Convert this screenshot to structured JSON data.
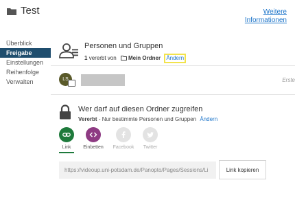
{
  "header": {
    "title": "Test",
    "more_info": "Weitere Informationen"
  },
  "sidebar": {
    "items": [
      {
        "label": "Überblick",
        "active": false
      },
      {
        "label": "Freigabe",
        "active": true
      },
      {
        "label": "Einstellungen",
        "active": false
      },
      {
        "label": "Reihenfolge",
        "active": false
      },
      {
        "label": "Verwalten",
        "active": false
      }
    ]
  },
  "people": {
    "title": "Personen und Gruppen",
    "inherited_count": "1",
    "inherited_text": "vererbt von",
    "folder_name": "Mein Ordner",
    "change_link": "Ändern"
  },
  "user_row": {
    "initials": "LS",
    "role": "Erste"
  },
  "access": {
    "title": "Wer darf auf diesen Ordner zugreifen",
    "status": "Vererbt",
    "status_detail": "- Nur bestimmte Personen und Gruppen",
    "change_link": "Ändern"
  },
  "share_options": [
    {
      "label": "Link",
      "icon": "link-icon",
      "color": "#1e7a3c",
      "selected": true
    },
    {
      "label": "Einbetten",
      "icon": "embed-icon",
      "color": "#8e3b83",
      "selected": false
    },
    {
      "label": "Facebook",
      "icon": "facebook-icon",
      "color": "#e3e3e3",
      "selected": false
    },
    {
      "label": "Twitter",
      "icon": "twitter-icon",
      "color": "#e3e3e3",
      "selected": false
    }
  ],
  "link_share": {
    "url": "https://videoup.uni-potsdam.de/Panopto/Pages/Sessions/Li",
    "copy_label": "Link kopieren"
  }
}
